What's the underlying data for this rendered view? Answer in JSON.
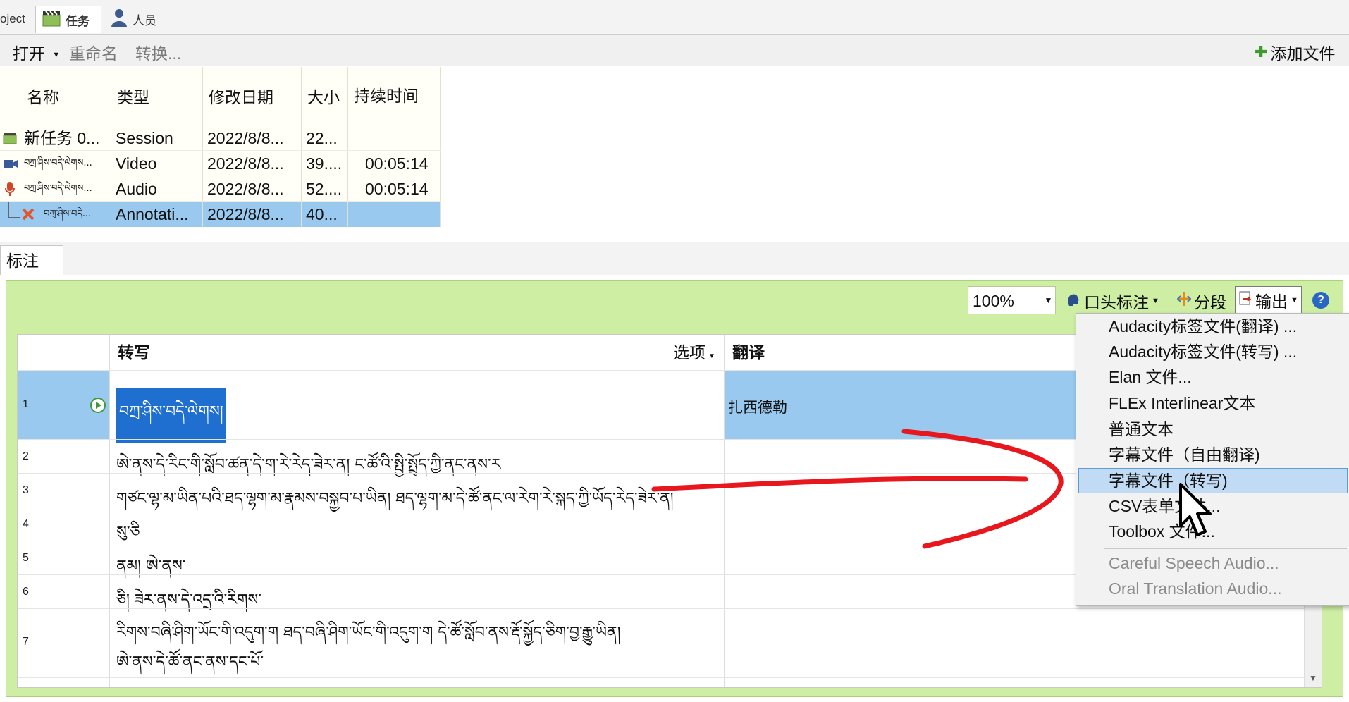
{
  "tabs": [
    {
      "label": "oject"
    },
    {
      "label": "任务"
    },
    {
      "label": "人员"
    }
  ],
  "toolbar": {
    "open": "打开",
    "rename": "重命名",
    "convert": "转换...",
    "add_file": "添加文件"
  },
  "file_grid": {
    "headers": [
      "名称",
      "类型",
      "修改日期",
      "大小",
      "持续时间"
    ],
    "rows": [
      {
        "name": "新任务 0...",
        "type": "Session",
        "date": "2022/8/8...",
        "size": "22...",
        "duration": ""
      },
      {
        "name": "བཀྲ་ཤིས་བདེ་ལེགས...",
        "type": "Video",
        "date": "2022/8/8...",
        "size": "39....",
        "duration": "00:05:14"
      },
      {
        "name": "བཀྲ་ཤིས་བདེ་ལེགས...",
        "type": "Audio",
        "date": "2022/8/8...",
        "size": "52....",
        "duration": "00:05:14"
      },
      {
        "name": "བཀྲ་ཤིས་བདེ...",
        "type": "Annotati...",
        "date": "2022/8/8...",
        "size": "40...",
        "duration": ""
      }
    ]
  },
  "annotation": {
    "tab_label": "标注",
    "zoom": "100%",
    "oral_annotation": "口头标注",
    "segment": "分段",
    "export": "输出",
    "columns": {
      "transcription": "转写",
      "options": "选项",
      "translation": "翻译"
    },
    "rows": [
      {
        "num": "1",
        "text": "བཀྲ་ཤིས་བདེ་ལེགས།",
        "translation": "扎西德勒"
      },
      {
        "num": "2",
        "text": "ཨེ་ནས་དེ་རིང་གི་སློབ་ཚན་དེ་ག་རེ་རེད་ཟེར་ན། ང་ཚོ་འི་སྤྱི་སྤྲོད་ཀྱི་ནང་ནས་ར",
        "translation": ""
      },
      {
        "num": "3",
        "text": "གཙང་ལྷ་མ་ཡིན་པའི་ཐད་ལྷག་མ་རྣམས་བསྐྱབ་པ་ཡིན། ཐད་ལྷག་མ་དེ་ཚོ་ནང་ལ་རེག་རེ་སྐད་ཀྱི་ཡོད་རེད་ཟེར་ན།",
        "translation": ""
      },
      {
        "num": "4",
        "text": "སུ་ཅི",
        "translation": ""
      },
      {
        "num": "5",
        "text": "ནམ། ཨེ་ནས་",
        "translation": ""
      },
      {
        "num": "6",
        "text": "ཅི། ཟེར་ནས་དེ་འདྲ་འི་རིགས་",
        "translation": ""
      },
      {
        "num": "7",
        "text": "རིགས་བཞི་ཤིག་ཡོང་གི་འདུག་ག ཐད་བཞི་ཤིག་ཡོང་གི་འདུག་ག དེ་ཚོ་སློབ་ནས་རྡོ་སྐྱོད་ཅིག་བྱ་རྒྱུ་ཡིན།",
        "text2": "ཨེ་ནས་དེ་ཚོ་ནང་ནས་དང་པོ་",
        "translation": ""
      }
    ]
  },
  "export_menu": {
    "items": [
      "Audacity标签文件(翻译) ...",
      "Audacity标签文件(转写) ...",
      "Elan 文件...",
      "FLEx Interlinear文本",
      "普通文本",
      "字幕文件（自由翻译)",
      "字幕文件（转写)",
      "CSV表单文件...",
      "Toolbox 文件..."
    ],
    "disabled_items": [
      "Careful Speech Audio...",
      "Oral Translation Audio..."
    ],
    "highlighted_index": 6
  },
  "colors": {
    "panel_green": "#cdeea3",
    "selection_blue": "#99c9ee",
    "arrow_red": "#e8171d"
  }
}
